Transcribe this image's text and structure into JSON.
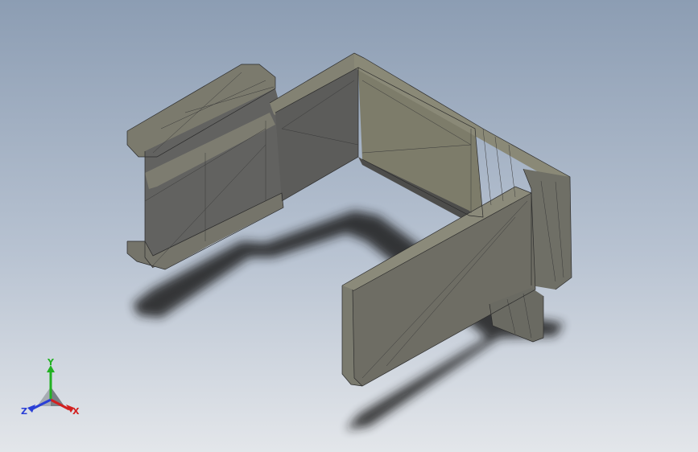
{
  "viewport": {
    "background_top": "#8c9db3",
    "background_bottom": "#e3e6ea"
  },
  "model": {
    "face_light": "#7e7d6e",
    "face_mid": "#6c6c62",
    "face_dark": "#5a5a55",
    "edge_color": "#2b2b2b"
  },
  "triad": {
    "x_label": "X",
    "y_label": "Y",
    "z_label": "Z",
    "x_color": "#d22020",
    "y_color": "#22b122",
    "z_color": "#2a3fd6"
  }
}
